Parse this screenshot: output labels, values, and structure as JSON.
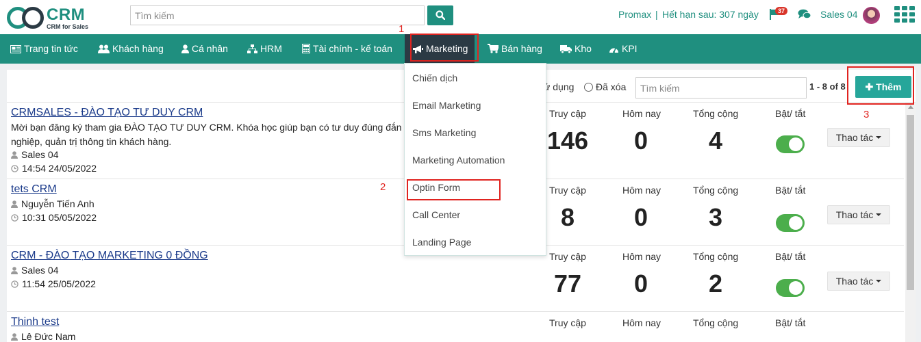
{
  "header": {
    "logo_text": "CRM",
    "logo_tagline": "CRM for Sales",
    "search_placeholder": "Tìm kiếm",
    "plan": "Promax",
    "separator": "|",
    "expiry": "Hết hạn sau: 307 ngày",
    "notification_count": "37",
    "user_name": "Sales 04"
  },
  "nav": {
    "items": [
      {
        "label": "Trang tin tức",
        "icon": "newspaper-icon"
      },
      {
        "label": "Khách hàng",
        "icon": "users-icon"
      },
      {
        "label": "Cá nhân",
        "icon": "user-icon"
      },
      {
        "label": "HRM",
        "icon": "sitemap-icon"
      },
      {
        "label": "Tài chính - kế toán",
        "icon": "calculator-icon"
      },
      {
        "label": "Marketing",
        "icon": "bullhorn-icon"
      },
      {
        "label": "Bán hàng",
        "icon": "cart-icon"
      },
      {
        "label": "Kho",
        "icon": "truck-icon"
      },
      {
        "label": "KPI",
        "icon": "dashboard-icon"
      }
    ],
    "active": "Marketing"
  },
  "marketing_menu": [
    "Chiến dịch",
    "Email Marketing",
    "Sms Marketing",
    "Marketing Automation",
    "Optin Form",
    "Call Center",
    "Landing Page"
  ],
  "annotations": {
    "step1": "1",
    "step2": "2",
    "step3": "3"
  },
  "toolbar": {
    "radio_in_use": "ử dụng",
    "radio_deleted": "Đã xóa",
    "search_placeholder": "Tìm kiếm",
    "paging": "1 - 8 of 8",
    "add_label": "Thêm"
  },
  "stat_labels": {
    "access": "Truy cập",
    "today": "Hôm nay",
    "total": "Tổng cộng",
    "toggle": "Bật/ tắt",
    "action": "Thao tác"
  },
  "forms": [
    {
      "title": "CRMSALES - ĐÀO TẠO TƯ DUY CRM",
      "desc": "Mời bạn đăng ký tham gia ĐÀO TẠO TƯ DUY CRM. Khóa học giúp bạn có tư duy đúng đắn nghiệp, quản trị thông tin khách hàng.",
      "owner": "Sales 04",
      "time": "14:54 24/05/2022",
      "access": "146",
      "today": "0",
      "total": "4",
      "enabled": true
    },
    {
      "title": "tets CRM",
      "desc": "",
      "owner": "Nguyễn Tiến Anh",
      "time": "10:31 05/05/2022",
      "access": "8",
      "today": "0",
      "total": "3",
      "enabled": true
    },
    {
      "title": "CRM - ĐÀO TẠO MARKETING 0 ĐỒNG",
      "desc": "",
      "owner": "Sales 04",
      "time": "11:54 25/05/2022",
      "access": "77",
      "today": "0",
      "total": "2",
      "enabled": true
    },
    {
      "title": "Thinh test",
      "desc": "",
      "owner": "Lê Đức Nam",
      "time": "",
      "access": "",
      "today": "",
      "total": "",
      "enabled": true
    }
  ]
}
